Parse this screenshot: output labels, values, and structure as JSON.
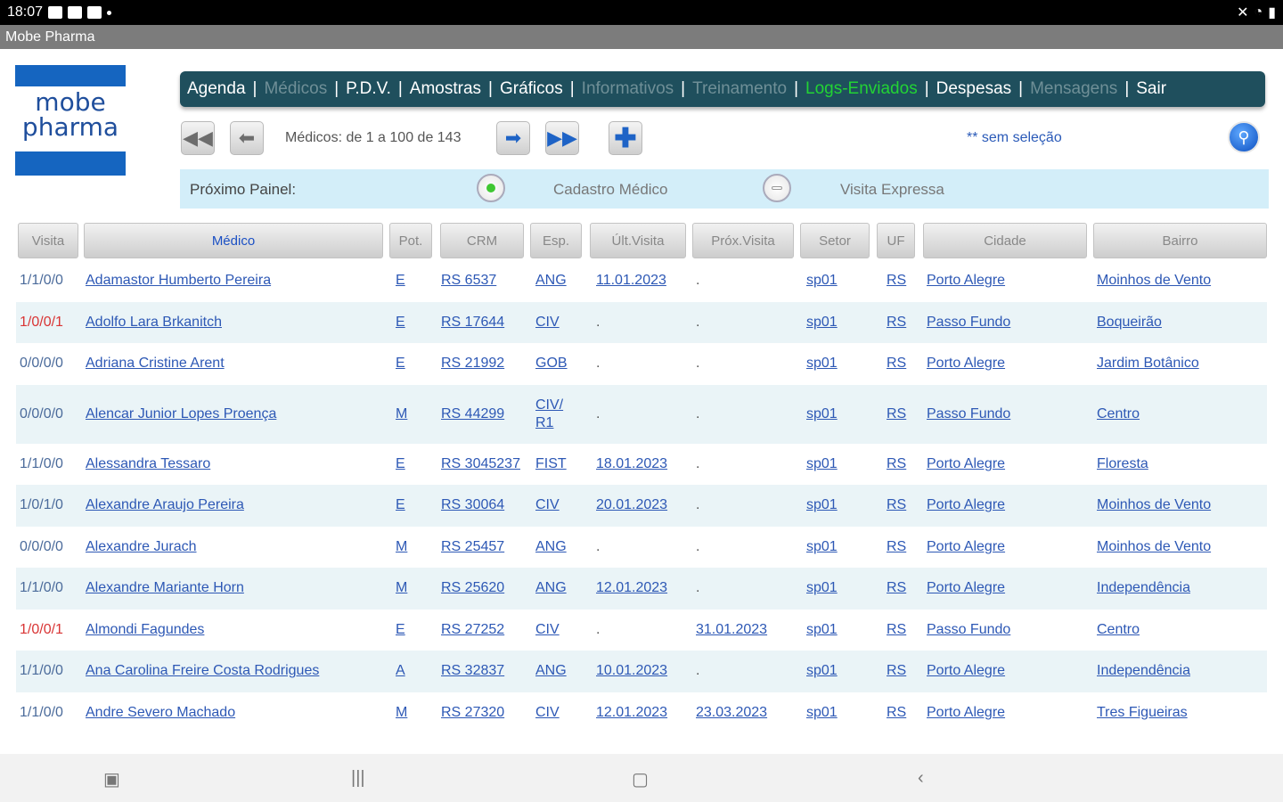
{
  "status_bar": {
    "time": "18:07"
  },
  "app_title": "Mobe Pharma",
  "logo": {
    "line1": "mobe",
    "line2": "pharma"
  },
  "menu": [
    {
      "label": "Agenda",
      "state": "active"
    },
    {
      "label": "Médicos",
      "state": "disabled"
    },
    {
      "label": "P.D.V.",
      "state": "active"
    },
    {
      "label": "Amostras",
      "state": "active"
    },
    {
      "label": "Gráficos",
      "state": "active"
    },
    {
      "label": "Informativos",
      "state": "disabled"
    },
    {
      "label": "Treinamento",
      "state": "disabled"
    },
    {
      "label": "Logs-Enviados",
      "state": "highlight"
    },
    {
      "label": "Despesas",
      "state": "active"
    },
    {
      "label": "Mensagens",
      "state": "disabled"
    },
    {
      "label": "Sair",
      "state": "active"
    }
  ],
  "pager": {
    "text": "Médicos: de 1 a 100 de 143"
  },
  "selection_text": "** sem seleção",
  "next_panel": {
    "label": "Próximo Painel:",
    "option1": "Cadastro Médico",
    "option2": "Visita Expressa"
  },
  "columns": {
    "visita": "Visita",
    "medico": "Médico",
    "pot": "Pot.",
    "crm": "CRM",
    "esp": "Esp.",
    "ult": "Últ.Visita",
    "prox": "Próx.Visita",
    "setor": "Setor",
    "uf": "UF",
    "cidade": "Cidade",
    "bairro": "Bairro"
  },
  "rows": [
    {
      "visita": "1/1/0/0",
      "medico": "Adamastor Humberto Pereira",
      "pot": "E",
      "crm": "RS 6537",
      "esp": "ANG",
      "ult": "11.01.2023",
      "prox": ".",
      "setor": "sp01",
      "uf": "RS",
      "cidade": "Porto Alegre",
      "bairro": "Moinhos de Vento"
    },
    {
      "visita": "1/0/0/1",
      "medico": "Adolfo Lara Brkanitch",
      "pot": "E",
      "crm": "RS 17644",
      "esp": "CIV",
      "ult": ".",
      "prox": ".",
      "setor": "sp01",
      "uf": "RS",
      "cidade": "Passo Fundo",
      "bairro": "Boqueirão"
    },
    {
      "visita": "0/0/0/0",
      "medico": "Adriana Cristine Arent",
      "pot": "E",
      "crm": "RS 21992",
      "esp": "GOB",
      "ult": ".",
      "prox": ".",
      "setor": "sp01",
      "uf": "RS",
      "cidade": "Porto Alegre",
      "bairro": "Jardim Botânico"
    },
    {
      "visita": "0/0/0/0",
      "medico": "Alencar Junior Lopes Proença",
      "pot": "M",
      "crm": "RS 44299",
      "esp": "CIV/ R1",
      "ult": ".",
      "prox": ".",
      "setor": "sp01",
      "uf": "RS",
      "cidade": "Passo Fundo",
      "bairro": "Centro"
    },
    {
      "visita": "1/1/0/0",
      "medico": "Alessandra Tessaro",
      "pot": "E",
      "crm": "RS 3045237",
      "esp": "FIST",
      "ult": "18.01.2023",
      "prox": ".",
      "setor": "sp01",
      "uf": "RS",
      "cidade": "Porto Alegre",
      "bairro": "Floresta"
    },
    {
      "visita": "1/0/1/0",
      "medico": "Alexandre Araujo Pereira",
      "pot": "E",
      "crm": "RS 30064",
      "esp": "CIV",
      "ult": "20.01.2023",
      "prox": ".",
      "setor": "sp01",
      "uf": "RS",
      "cidade": "Porto Alegre",
      "bairro": "Moinhos de Vento"
    },
    {
      "visita": "0/0/0/0",
      "medico": "Alexandre Jurach",
      "pot": "M",
      "crm": "RS 25457",
      "esp": "ANG",
      "ult": ".",
      "prox": ".",
      "setor": "sp01",
      "uf": "RS",
      "cidade": "Porto Alegre",
      "bairro": "Moinhos de Vento"
    },
    {
      "visita": "1/1/0/0",
      "medico": "Alexandre Mariante Horn",
      "pot": "M",
      "crm": "RS 25620",
      "esp": "ANG",
      "ult": "12.01.2023",
      "prox": ".",
      "setor": "sp01",
      "uf": "RS",
      "cidade": "Porto Alegre",
      "bairro": "Independência"
    },
    {
      "visita": "1/0/0/1",
      "medico": "Almondi Fagundes",
      "pot": "E",
      "crm": "RS 27252",
      "esp": "CIV",
      "ult": ".",
      "prox": "31.01.2023",
      "setor": "sp01",
      "uf": "RS",
      "cidade": "Passo Fundo",
      "bairro": "Centro"
    },
    {
      "visita": "1/1/0/0",
      "medico": "Ana Carolina Freire Costa Rodrigues",
      "pot": "A",
      "crm": "RS 32837",
      "esp": "ANG",
      "ult": "10.01.2023",
      "prox": ".",
      "setor": "sp01",
      "uf": "RS",
      "cidade": "Porto Alegre",
      "bairro": "Independência"
    },
    {
      "visita": "1/1/0/0",
      "medico": "Andre Severo Machado",
      "pot": "M",
      "crm": "RS 27320",
      "esp": "CIV",
      "ult": "12.01.2023",
      "prox": "23.03.2023",
      "setor": "sp01",
      "uf": "RS",
      "cidade": "Porto Alegre",
      "bairro": "Tres Figueiras"
    }
  ],
  "colors": {
    "menu_bg": "#1f4f5d",
    "highlight": "#22d334",
    "link": "#2d58b5",
    "alt_row": "#eaf4f7"
  }
}
